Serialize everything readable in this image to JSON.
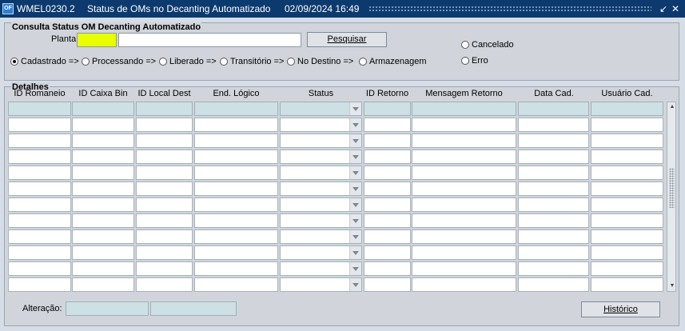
{
  "titlebar": {
    "app_icon": "oracle-forms-icon",
    "form_code": "WMEL0230.2",
    "title": "Status de OMs no Decanting Automatizado",
    "datetime": "02/09/2024 16:49",
    "minimize_glyph": "↙",
    "close_glyph": "✕"
  },
  "consulta": {
    "title": "Consulta Status OM Decanting Automatizado",
    "planta_label": "Planta",
    "planta_code_value": "",
    "planta_name_value": "",
    "search_button": "Pesquisar",
    "status_options": [
      {
        "label": "Cadastrado =>",
        "selected": true
      },
      {
        "label": "Processando =>",
        "selected": false
      },
      {
        "label": "Liberado =>",
        "selected": false
      },
      {
        "label": "Transitório =>",
        "selected": false
      },
      {
        "label": "No Destino =>",
        "selected": false
      },
      {
        "label": "Armazenagem",
        "selected": false
      },
      {
        "label": "Cancelado",
        "selected": false
      },
      {
        "label": "Erro",
        "selected": false
      }
    ]
  },
  "detalhes": {
    "title": "Detalhes",
    "columns": [
      "ID Romaneio",
      "ID Caixa Bin",
      "ID Local Dest",
      "End. Lógico",
      "Status",
      "ID Retorno",
      "Mensagem Retorno",
      "Data Cad.",
      "Usuário Cad."
    ],
    "row_count": 11
  },
  "footer": {
    "alteracao_label": "Alteração:",
    "alteracao_value_1": "",
    "alteracao_value_2": "",
    "historico_button": "Histórico"
  },
  "colors": {
    "titlebar_bg": "#0c3a6e",
    "highlight_field": "#e8ff00",
    "readonly_field": "#cde0e4"
  }
}
